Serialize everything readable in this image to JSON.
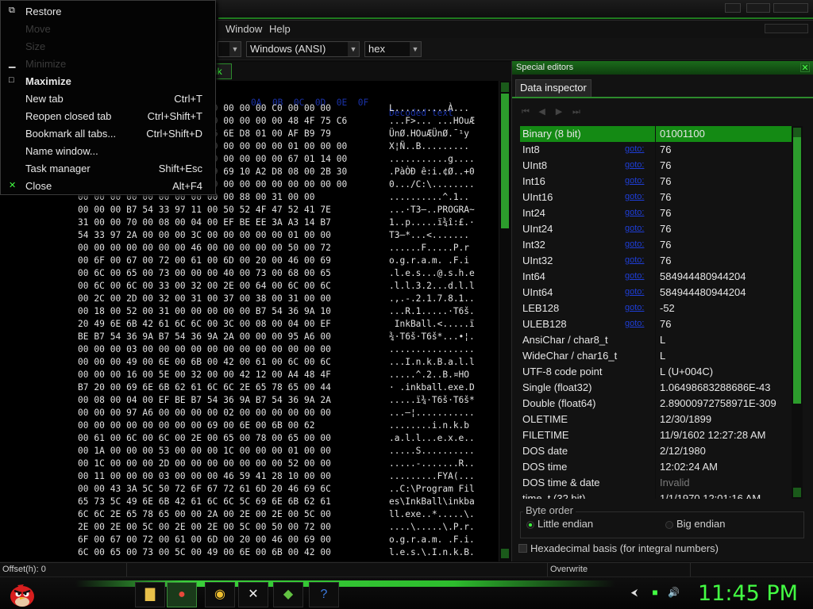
{
  "menubar": {
    "window": "Window",
    "help": "Help"
  },
  "toolbar": {
    "charset": "Windows (ANSI)",
    "display": "hex"
  },
  "tab": {
    "label": "nk"
  },
  "context_menu": {
    "items": [
      {
        "label": "Restore",
        "shortcut": "",
        "disabled": false,
        "icon": "restore-icon"
      },
      {
        "label": "Move",
        "shortcut": "",
        "disabled": true,
        "icon": ""
      },
      {
        "label": "Size",
        "shortcut": "",
        "disabled": true,
        "icon": ""
      },
      {
        "label": "Minimize",
        "shortcut": "",
        "disabled": true,
        "icon": "minimize-icon"
      },
      {
        "label": "Maximize",
        "shortcut": "",
        "disabled": false,
        "icon": "maximize-icon"
      },
      {
        "label": "New tab",
        "shortcut": "Ctrl+T",
        "disabled": false,
        "icon": ""
      },
      {
        "label": "Reopen closed tab",
        "shortcut": "Ctrl+Shift+T",
        "disabled": false,
        "icon": ""
      },
      {
        "label": "Bookmark all tabs...",
        "shortcut": "Ctrl+Shift+D",
        "disabled": false,
        "icon": ""
      },
      {
        "label": "Name window...",
        "shortcut": "",
        "disabled": false,
        "icon": ""
      },
      {
        "label": "Task manager",
        "shortcut": "Shift+Esc",
        "disabled": false,
        "icon": ""
      },
      {
        "label": "Close",
        "shortcut": "Alt+F4",
        "disabled": false,
        "icon": "close-icon"
      }
    ]
  },
  "hex": {
    "header_cols": "0A  0B  0C  0D  0E  0F",
    "header_decoded": "Decoded text",
    "rows": [
      {
        "off": "",
        "bytes": "                        00 00 00 00 C0 00 00 00",
        "text": "L..........À..."
      },
      {
        "off": "",
        "bytes": "                        20 00 00 00 00 48 4F 75 C6",
        "text": "...F>... ...HOuÆ"
      },
      {
        "off": "",
        "bytes": "                        D6 6E D8 01 00 AF B9 79",
        "text": "ÜnØ.HOuÆÜnØ.¯¹y"
      },
      {
        "off": "",
        "bytes": "                        00 00 00 00 00 01 00 00 00",
        "text": "X¦Ñ..B........."
      },
      {
        "off": "",
        "bytes": "                        00 00 00 00 00 67 01 14 00",
        "text": "...........g...."
      },
      {
        "off": "",
        "bytes": "                        A9 69 10 A2 D8 08 00 2B 30",
        "text": ".PàÒÐ ê:i.¢Ø..+0"
      },
      {
        "off": "",
        "bytes": "                        00 00 00 00 00 00 00 00 00",
        "text": "0.../C:\\........"
      },
      {
        "off": "",
        "bytes": "00 00 00 00 00 00 00 00 00 00 88 00 31 00 00",
        "text": "..........^.1.."
      },
      {
        "off": "",
        "bytes": "00 00 00 B7 54 33 97 11 00 50 52 4F 47 52 41 7E",
        "text": "...·T3—..PROGRA~"
      },
      {
        "off": "",
        "bytes": "31 00 00 70 00 08 00 04 00 EF BE EE 3A A3 14 B7",
        "text": "1..p.....ï¾î:£.·"
      },
      {
        "off": "",
        "bytes": "54 33 97 2A 00 00 00 3C 00 00 00 00 00 01 00 00",
        "text": "T3—*...<......."
      },
      {
        "off": "",
        "bytes": "00 00 00 00 00 00 00 46 00 00 00 00 00 50 00 72",
        "text": "......F.....P.r"
      },
      {
        "off": "",
        "bytes": "00 6F 00 67 00 72 00 61 00 6D 00 20 00 46 00 69",
        "text": "o.g.r.a.m. .F.i"
      },
      {
        "off": "",
        "bytes": "00 6C 00 65 00 73 00 00 00 40 00 73 00 68 00 65",
        "text": ".l.e.s...@.s.h.e"
      },
      {
        "off": "",
        "bytes": "00 6C 00 6C 00 33 00 32 00 2E 00 64 00 6C 00 6C",
        "text": ".l.l.3.2...d.l.l"
      },
      {
        "off": "",
        "bytes": "00 2C 00 2D 00 32 00 31 00 37 00 38 00 31 00 00",
        "text": ".,.-.2.1.7.8.1.."
      },
      {
        "off": "",
        "bytes": "00 18 00 52 00 31 00 00 00 00 00 B7 54 36 9A 10",
        "text": "...R.1.....·T6š."
      },
      {
        "off": "",
        "bytes": "20 49 6E 6B 42 61 6C 6C 00 3C 00 08 00 04 00 EF",
        "text": " InkBall.<.....ï"
      },
      {
        "off": "",
        "bytes": "BE B7 54 36 9A B7 54 36 9A 2A 00 00 00 95 A6 00",
        "text": "¾·T6š·T6š*...•¦."
      },
      {
        "off": "",
        "bytes": "00 00 00 03 00 00 00 00 00 00 00 00 00 00 00 00",
        "text": "................"
      },
      {
        "off": "",
        "bytes": "00 00 00 49 00 6E 00 6B 00 42 00 61 00 6C 00 6C",
        "text": "...I.n.k.B.a.l.l"
      },
      {
        "off": "",
        "bytes": "00 00 00 16 00 5E 00 32 00 00 42 12 00 A4 48 4F",
        "text": ".....^.2..B.¤HO"
      },
      {
        "off": "",
        "bytes": "B7 20 00 69 6E 6B 62 61 6C 6C 2E 65 78 65 00 44",
        "text": "· .inkball.exe.D"
      },
      {
        "off": "",
        "bytes": "00 08 00 04 00 EF BE B7 54 36 9A B7 54 36 9A 2A",
        "text": ".....ï¾·T6š·T6š*"
      },
      {
        "off": "",
        "bytes": "00 00 00 97 A6 00 00 00 00 02 00 00 00 00 00 00",
        "text": "...—¦..........."
      },
      {
        "off": "",
        "bytes": "00 00 00 00 00 00 00 00 69 00 6E 00 6B 00 62",
        "text": "........i.n.k.b"
      },
      {
        "off": "",
        "bytes": "00 61 00 6C 00 6C 00 2E 00 65 00 78 00 65 00 00",
        "text": ".a.l.l...e.x.e.."
      },
      {
        "off": "",
        "bytes": "00 1A 00 00 00 53 00 00 00 1C 00 00 00 01 00 00",
        "text": ".....S.........."
      },
      {
        "off": "",
        "bytes": "00 1C 00 00 00 2D 00 00 00 00 00 00 00 52 00 00",
        "text": ".....-.......R.."
      },
      {
        "off": "",
        "bytes": "00 11 00 00 00 03 00 00 00 46 59 41 28 10 00 00",
        "text": ".........FYA(..."
      },
      {
        "off": "",
        "bytes": "00 00 43 3A 5C 50 72 6F 67 72 61 6D 20 46 69 6C",
        "text": "..C:\\Program Fil"
      },
      {
        "off": "",
        "bytes": "65 73 5C 49 6E 6B 42 61 6C 6C 5C 69 6E 6B 62 61",
        "text": "es\\InkBall\\inkba"
      },
      {
        "off": "",
        "bytes": "6C 6C 2E 65 78 65 00 00 2A 00 2E 00 2E 00 5C 00",
        "text": "ll.exe..*.....\\."
      },
      {
        "off": "",
        "bytes": "2E 00 2E 00 5C 00 2E 00 2E 00 5C 00 50 00 72 00",
        "text": "....\\.....\\.P.r."
      },
      {
        "off": "",
        "bytes": "6F 00 67 00 72 00 61 00 6D 00 20 00 46 00 69 00",
        "text": "o.g.r.a.m. .F.i."
      },
      {
        "off": "",
        "bytes": "6C 00 65 00 73 00 5C 00 49 00 6E 00 6B 00 42 00",
        "text": "l.e.s.\\.I.n.k.B."
      }
    ]
  },
  "special": {
    "title": "Special editors",
    "tab": "Data inspector",
    "goto": "goto:",
    "rows": [
      {
        "name": "Binary (8 bit)",
        "goto": false,
        "value": "01001100",
        "selected": true
      },
      {
        "name": "Int8",
        "goto": true,
        "value": "76"
      },
      {
        "name": "UInt8",
        "goto": true,
        "value": "76"
      },
      {
        "name": "Int16",
        "goto": true,
        "value": "76"
      },
      {
        "name": "UInt16",
        "goto": true,
        "value": "76"
      },
      {
        "name": "Int24",
        "goto": true,
        "value": "76"
      },
      {
        "name": "UInt24",
        "goto": true,
        "value": "76"
      },
      {
        "name": "Int32",
        "goto": true,
        "value": "76"
      },
      {
        "name": "UInt32",
        "goto": true,
        "value": "76"
      },
      {
        "name": "Int64",
        "goto": true,
        "value": "584944480944204"
      },
      {
        "name": "UInt64",
        "goto": true,
        "value": "584944480944204"
      },
      {
        "name": "LEB128",
        "goto": true,
        "value": "-52"
      },
      {
        "name": "ULEB128",
        "goto": true,
        "value": "76"
      },
      {
        "name": "AnsiChar / char8_t",
        "goto": false,
        "value": "L"
      },
      {
        "name": "WideChar / char16_t",
        "goto": false,
        "value": "L"
      },
      {
        "name": "UTF-8 code point",
        "goto": false,
        "value": "L (U+004C)"
      },
      {
        "name": "Single (float32)",
        "goto": false,
        "value": "1.06498683288686E-43"
      },
      {
        "name": "Double (float64)",
        "goto": false,
        "value": "2.89000972758971E-309"
      },
      {
        "name": "OLETIME",
        "goto": false,
        "value": "12/30/1899"
      },
      {
        "name": "FILETIME",
        "goto": false,
        "value": "11/9/1602 12:27:28 AM"
      },
      {
        "name": "DOS date",
        "goto": false,
        "value": "2/12/1980"
      },
      {
        "name": "DOS time",
        "goto": false,
        "value": "12:02:24 AM"
      },
      {
        "name": "DOS time & date",
        "goto": false,
        "value": "Invalid",
        "muted": true
      },
      {
        "name": "time_t (32 bit)",
        "goto": false,
        "value": "1/1/1970 12:01:16 AM"
      }
    ],
    "byte_order_label": "Byte order",
    "little_endian": "Little endian",
    "big_endian": "Big endian",
    "hex_basis": "Hexadecimal basis (for integral numbers)"
  },
  "statusbar": {
    "offset": "Offset(h): 0",
    "mode": "Overwrite"
  },
  "taskbar": {
    "clock": "11:45 PM"
  }
}
